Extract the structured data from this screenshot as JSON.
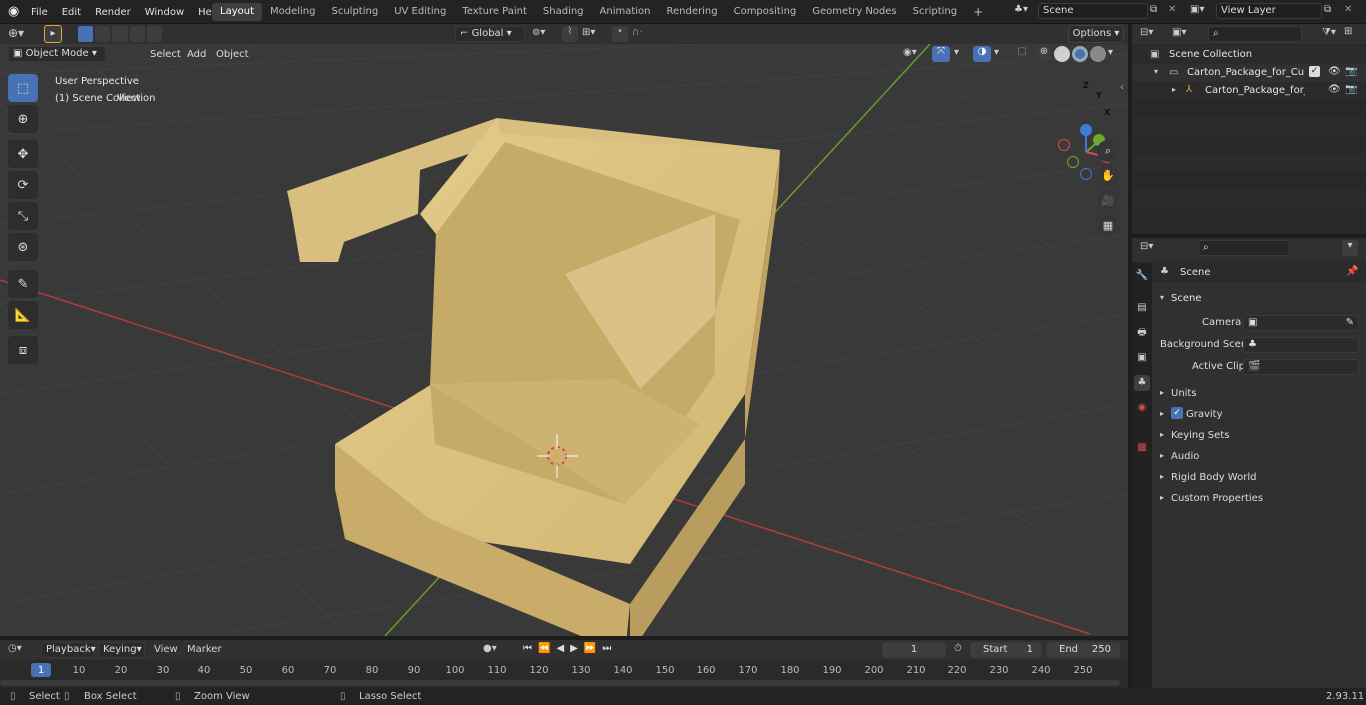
{
  "menu": {
    "file": "File",
    "edit": "Edit",
    "render": "Render",
    "window": "Window",
    "help": "Help"
  },
  "workspaces": [
    "Layout",
    "Modeling",
    "Sculpting",
    "UV Editing",
    "Texture Paint",
    "Shading",
    "Animation",
    "Rendering",
    "Compositing",
    "Geometry Nodes",
    "Scripting"
  ],
  "scene_field": "Scene",
  "view_layer_field": "View Layer",
  "viewport": {
    "mode": "Object Mode",
    "view": "View",
    "select": "Select",
    "add": "Add",
    "object": "Object",
    "transform_orientation": "Global",
    "options": "Options",
    "overlay_title": "User Perspective",
    "overlay_subtitle": "(1) Scene Collection"
  },
  "gizmo": {
    "x": "X",
    "y": "Y",
    "z": "Z"
  },
  "outliner": {
    "root": "Scene Collection",
    "items": [
      {
        "label": "Carton_Package_for_Cupcake"
      },
      {
        "label": "Carton_Package_for_Cup"
      }
    ]
  },
  "properties": {
    "context": "Scene",
    "panel_title": "Scene",
    "camera_label": "Camera",
    "background_scene_label": "Background Scene",
    "active_clip_label": "Active Clip",
    "sections": [
      "Units",
      "Gravity",
      "Keying Sets",
      "Audio",
      "Rigid Body World",
      "Custom Properties"
    ],
    "gravity_checked": true
  },
  "timeline": {
    "playback": "Playback",
    "keying": "Keying",
    "view": "View",
    "marker": "Marker",
    "current_frame": "1",
    "start_label": "Start",
    "start": "1",
    "end_label": "End",
    "end": "250",
    "ticks": [
      "1",
      "10",
      "20",
      "30",
      "40",
      "50",
      "60",
      "70",
      "80",
      "90",
      "100",
      "110",
      "120",
      "130",
      "140",
      "150",
      "160",
      "170",
      "180",
      "190",
      "200",
      "210",
      "220",
      "230",
      "240",
      "250"
    ]
  },
  "status": {
    "select": "Select",
    "box_select": "Box Select",
    "zoom_view": "Zoom View",
    "lasso_select": "Lasso Select",
    "version": "2.93.11"
  },
  "colors": {
    "accent": "#4772b3",
    "box": "#dcc283",
    "x_axis": "#c0393c",
    "y_axis": "#6ca130"
  }
}
